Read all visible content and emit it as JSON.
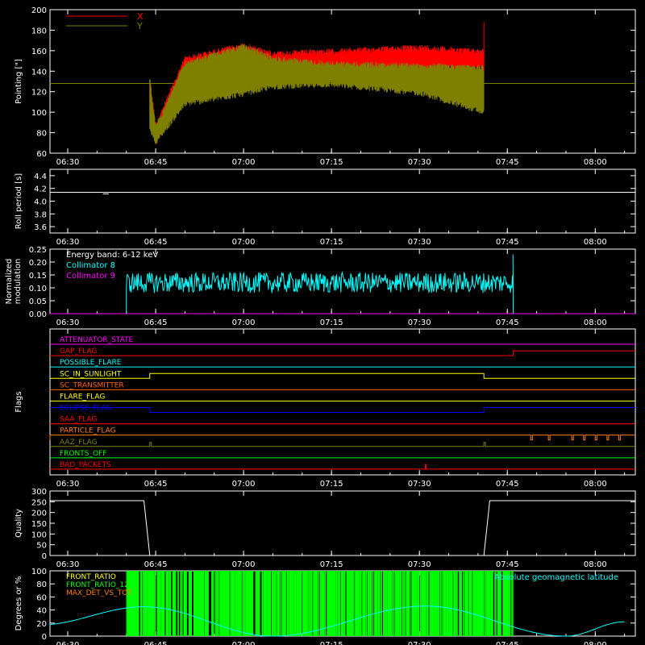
{
  "chart_data": [
    {
      "type": "line",
      "ylabel": "Pointing [\"]",
      "ylim": [
        60,
        200
      ],
      "yticks": [
        60,
        80,
        100,
        120,
        140,
        160,
        180,
        200
      ],
      "xticks": [
        "06:30",
        "06:45",
        "07:00",
        "07:15",
        "07:30",
        "07:45",
        "08:00"
      ],
      "legend": "top-left",
      "series": [
        {
          "name": "X",
          "color": "#ff0000",
          "x": [
            "06:44",
            "06:45",
            "06:50",
            "07:00",
            "07:05",
            "07:15",
            "07:30",
            "07:41"
          ],
          "upper": [
            135,
            90,
            155,
            168,
            160,
            162,
            166,
            162
          ],
          "lower": [
            95,
            68,
            118,
            130,
            133,
            138,
            140,
            140
          ]
        },
        {
          "name": "Y",
          "color": "#808000",
          "x": [
            "06:44",
            "06:45",
            "06:50",
            "07:00",
            "07:05",
            "07:15",
            "07:30",
            "07:41"
          ],
          "upper": [
            135,
            88,
            150,
            167,
            155,
            150,
            148,
            146
          ],
          "lower": [
            82,
            68,
            105,
            115,
            122,
            124,
            116,
            97
          ]
        },
        {
          "name": "",
          "color": "#808000",
          "x": [
            "06:25",
            "08:05"
          ],
          "values": [
            128,
            128
          ]
        }
      ]
    },
    {
      "type": "line",
      "ylabel": "Roll period [s]",
      "ylim": [
        3.5,
        4.5
      ],
      "yticks": [
        "3.6",
        "3.8",
        "4.0",
        "4.2",
        "4.4"
      ],
      "xticks": [
        "06:30",
        "06:45",
        "07:00",
        "07:15",
        "07:30",
        "07:45",
        "08:00"
      ],
      "series": [
        {
          "name": "",
          "color": "#ffffff",
          "x": [
            "06:28",
            "08:05"
          ],
          "values": [
            4.14,
            4.14
          ]
        }
      ]
    },
    {
      "type": "line",
      "ylabel": "Normalized modulation",
      "ylim": [
        0,
        0.25
      ],
      "yticks": [
        "0.00",
        "0.05",
        "0.10",
        "0.15",
        "0.20",
        "0.25"
      ],
      "xticks": [
        "06:30",
        "06:45",
        "07:00",
        "07:15",
        "07:30",
        "07:45",
        "08:00"
      ],
      "annotation": "Energy band: 6-12 keV",
      "legend": "top-left",
      "series": [
        {
          "name": "Collimator 8",
          "color": "#00ffff",
          "x_start": "06:40",
          "x_end": "07:46",
          "mean": 0.12,
          "spread": 0.04
        },
        {
          "name": "Collimator 9",
          "color": "#ff00ff",
          "x": [
            "06:25",
            "08:05"
          ],
          "values": [
            0,
            0
          ]
        }
      ]
    },
    {
      "type": "line",
      "ylabel": "Flags",
      "xticks": [
        "06:30",
        "06:45",
        "07:00",
        "07:15",
        "07:30",
        "07:45",
        "08:00"
      ],
      "flags": [
        {
          "name": "ATTENUATOR_STATE",
          "color": "#ff00ff"
        },
        {
          "name": "GAP_FLAG",
          "color": "#ff0000"
        },
        {
          "name": "POSSIBLE_FLARE",
          "color": "#00ffff"
        },
        {
          "name": "SC_IN_SUNLIGHT",
          "color": "#ffff00"
        },
        {
          "name": "SC_TRANSMITTER",
          "color": "#ff6400"
        },
        {
          "name": "FLARE_FLAG",
          "color": "#ffff00"
        },
        {
          "name": "ECLIPSE_FLAG",
          "color": "#0000ff"
        },
        {
          "name": "SAA_FLAG",
          "color": "#ff0000"
        },
        {
          "name": "PARTICLE_FLAG",
          "color": "#ff8000"
        },
        {
          "name": "AAZ_FLAG",
          "color": "#808000"
        },
        {
          "name": "FRONTS_OFF",
          "color": "#00ff00"
        },
        {
          "name": "BAD_PACKETS",
          "color": "#ff0000"
        }
      ]
    },
    {
      "type": "line",
      "ylabel": "Quality",
      "ylim": [
        0,
        300
      ],
      "yticks": [
        0,
        50,
        100,
        150,
        200,
        250,
        300
      ],
      "xticks": [
        "06:30",
        "06:45",
        "07:00",
        "07:15",
        "07:30",
        "07:45",
        "08:00"
      ],
      "series": [
        {
          "name": "",
          "color": "#ffffff",
          "x": [
            "06:25",
            "06:43",
            "06:44",
            "07:41",
            "07:42",
            "08:05"
          ],
          "values": [
            255,
            255,
            0,
            0,
            255,
            255
          ]
        }
      ]
    },
    {
      "type": "line",
      "ylabel": "Degrees or %",
      "ylim": [
        0,
        100
      ],
      "yticks": [
        0,
        20,
        40,
        60,
        80,
        100
      ],
      "xticks": [
        "06:30",
        "06:45",
        "07:00",
        "07:15",
        "07:30",
        "07:45",
        "08:00"
      ],
      "legend": "top-left",
      "series": [
        {
          "name": "FRONT_RATIO",
          "color": "#ffff00"
        },
        {
          "name": "FRONT_RATIO_1225",
          "color": "#00ff00",
          "x_start": "06:40",
          "x_end": "07:46",
          "description_values": [
            0,
            100
          ]
        },
        {
          "name": "MAX_DET_VS_TOT",
          "color": "#ff8000"
        },
        {
          "name": "Absolute geomagnetic latitude",
          "color": "#00ffff",
          "x": [
            "06:25",
            "06:43",
            "07:05",
            "07:31",
            "07:55",
            "08:05"
          ],
          "values": [
            17,
            45,
            0,
            46,
            0,
            22
          ]
        }
      ]
    }
  ],
  "colors": {
    "background": "#000000",
    "axes": "#ffffff",
    "text": "#ffffff"
  }
}
